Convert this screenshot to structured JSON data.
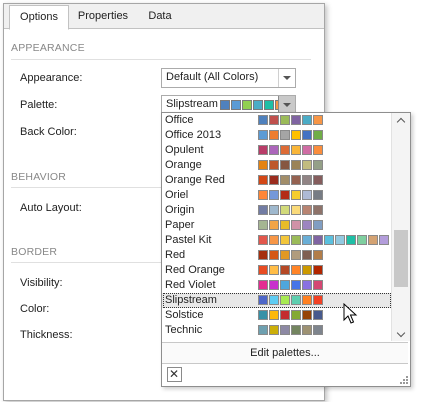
{
  "tabs": [
    {
      "label": "Options",
      "active": true
    },
    {
      "label": "Properties",
      "active": false
    },
    {
      "label": "Data",
      "active": false
    }
  ],
  "sections": {
    "appearance": "APPEARANCE",
    "behavior": "BEHAVIOR",
    "border": "BORDER"
  },
  "properties": {
    "appearance": {
      "label": "Appearance:",
      "value": "Default (All Colors)"
    },
    "palette": {
      "label": "Palette:",
      "value": "Slipstream",
      "swatches": [
        "#4f81bd",
        "#5b9bd5",
        "#92d050",
        "#4bacc6",
        "#1fbfa6",
        "#f79646"
      ]
    },
    "back_color": {
      "label": "Back Color:"
    },
    "auto_layout": {
      "label": "Auto Layout:"
    },
    "visibility": {
      "label": "Visibility:"
    },
    "color": {
      "label": "Color:"
    },
    "thickness": {
      "label": "Thickness:"
    }
  },
  "palettes": [
    {
      "name": "Office",
      "colors": [
        "#4f81bd",
        "#c0504d",
        "#9bbb59",
        "#8064a2",
        "#4bacc6",
        "#f79646"
      ]
    },
    {
      "name": "Office 2013",
      "colors": [
        "#5b9bd5",
        "#ed7d31",
        "#a5a5a5",
        "#ffc000",
        "#4472c4",
        "#70ad47"
      ]
    },
    {
      "name": "Opulent",
      "colors": [
        "#b83d68",
        "#ac66bb",
        "#de6c36",
        "#f9b639",
        "#cf6da4",
        "#fa8d3d"
      ]
    },
    {
      "name": "Orange",
      "colors": [
        "#e48312",
        "#bd582c",
        "#865640",
        "#9b8357",
        "#c2bc80",
        "#94a088"
      ]
    },
    {
      "name": "Orange Red",
      "colors": [
        "#d34817",
        "#9b2d1f",
        "#a28e6a",
        "#956251",
        "#918485",
        "#855d5d"
      ]
    },
    {
      "name": "Oriel",
      "colors": [
        "#fe8637",
        "#7598d9",
        "#b32c16",
        "#f5cd2d",
        "#aebad5",
        "#777c84"
      ]
    },
    {
      "name": "Origin",
      "colors": [
        "#727ca3",
        "#9fb8cd",
        "#d2da7a",
        "#fada7a",
        "#b88472",
        "#8e736a"
      ]
    },
    {
      "name": "Paper",
      "colors": [
        "#a5b592",
        "#f3a447",
        "#e7bc29",
        "#d092a7",
        "#9c85c0",
        "#809ec2"
      ]
    },
    {
      "name": "Pastel Kit",
      "colors": [
        "#e2574c",
        "#f79646",
        "#f3c63a",
        "#9bbb59",
        "#6aaed6",
        "#8064a2",
        "#5bc0de",
        "#93c9e0",
        "#1fbfa6",
        "#7fcfa0",
        "#d4a373",
        "#b39ddb"
      ]
    },
    {
      "name": "Red",
      "colors": [
        "#a5300f",
        "#d55816",
        "#e19825",
        "#b19c7d",
        "#7f5f52",
        "#b27d49"
      ]
    },
    {
      "name": "Red Orange",
      "colors": [
        "#e84c22",
        "#ffbd47",
        "#b64926",
        "#ff8427",
        "#cc9900",
        "#b22600"
      ]
    },
    {
      "name": "Red Violet",
      "colors": [
        "#e32d91",
        "#c830cc",
        "#4ea6dc",
        "#4775e7",
        "#8971e1",
        "#d54773"
      ]
    },
    {
      "name": "Slipstream",
      "colors": [
        "#4e67c8",
        "#5eccf3",
        "#a7ea52",
        "#5dceaf",
        "#ff8021",
        "#f14124"
      ],
      "selected": true
    },
    {
      "name": "Solstice",
      "colors": [
        "#3891a7",
        "#feb80a",
        "#c32d2e",
        "#84aa33",
        "#964305",
        "#475a8d"
      ]
    },
    {
      "name": "Technic",
      "colors": [
        "#6ea0b0",
        "#ccaf0a",
        "#8d89a4",
        "#748560",
        "#9e9273",
        "#7e848d"
      ]
    }
  ],
  "popup": {
    "edit_label": "Edit palettes...",
    "close_glyph": "✕"
  }
}
